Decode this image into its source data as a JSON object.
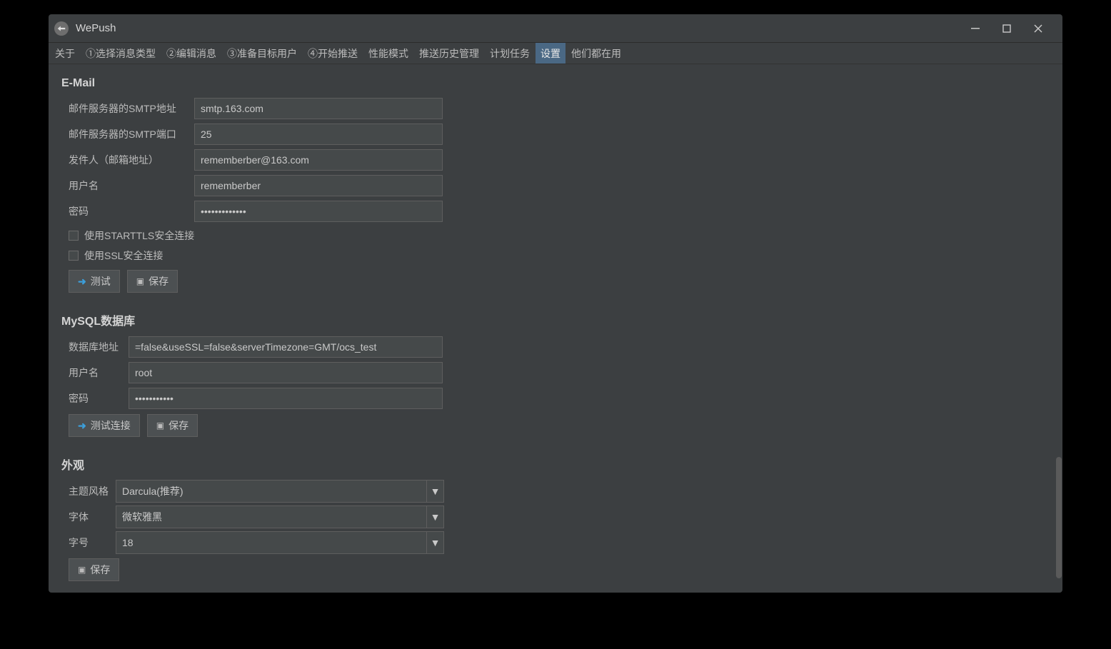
{
  "app": {
    "title": "WePush"
  },
  "tabs": [
    {
      "label": "关于",
      "active": false
    },
    {
      "label": "①选择消息类型",
      "active": false
    },
    {
      "label": "②编辑消息",
      "active": false
    },
    {
      "label": "③准备目标用户",
      "active": false
    },
    {
      "label": "④开始推送",
      "active": false
    },
    {
      "label": "性能模式",
      "active": false
    },
    {
      "label": "推送历史管理",
      "active": false
    },
    {
      "label": "计划任务",
      "active": false
    },
    {
      "label": "设置",
      "active": true
    },
    {
      "label": "他们都在用",
      "active": false
    }
  ],
  "email": {
    "title": "E-Mail",
    "rows": {
      "smtp_addr_label": "邮件服务器的SMTP地址",
      "smtp_addr_value": "smtp.163.com",
      "smtp_port_label": "邮件服务器的SMTP端口",
      "smtp_port_value": "25",
      "sender_label": "发件人（邮箱地址）",
      "sender_value": "rememberber@163.com",
      "user_label": "用户名",
      "user_value": "rememberber",
      "pass_label": "密码",
      "pass_value": "•••••••••••••"
    },
    "starttls_label": "使用STARTTLS安全连接",
    "ssl_label": "使用SSL安全连接",
    "test_button": "测试",
    "save_button": "保存"
  },
  "mysql": {
    "title": "MySQL数据库",
    "addr_label": "数据库地址",
    "addr_value": "=false&useSSL=false&serverTimezone=GMT/ocs_test",
    "user_label": "用户名",
    "user_value": "root",
    "pass_label": "密码",
    "pass_value": "•••••••••••",
    "test_button": "测试连接",
    "save_button": "保存"
  },
  "appearance": {
    "title": "外观",
    "theme_label": "主题风格",
    "theme_value": "Darcula(推荐)",
    "font_label": "字体",
    "font_value": "微软雅黑",
    "size_label": "字号",
    "size_value": "18",
    "save_button": "保存"
  }
}
